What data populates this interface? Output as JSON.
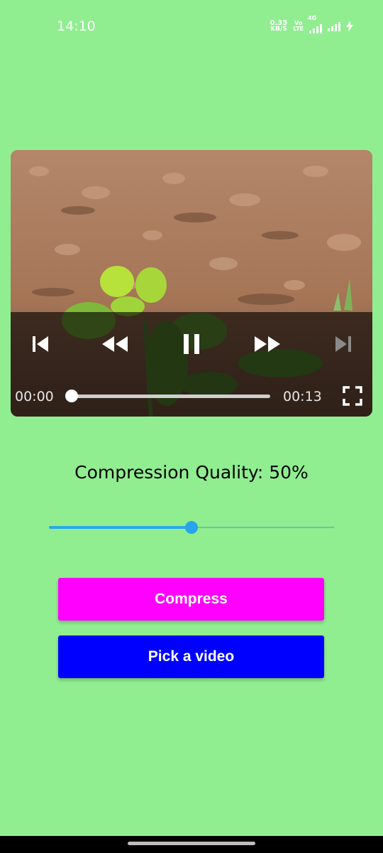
{
  "status_bar": {
    "time": "14:10",
    "net_speed_value": "0.35",
    "net_speed_unit": "KB/S",
    "volte_top": "Vo",
    "volte_bottom": "LTE",
    "network_type": "4G",
    "icons": [
      "network-speed-icon",
      "volte-icon",
      "signal-4g-icon",
      "signal-icon",
      "charging-icon"
    ]
  },
  "player": {
    "current_time": "00:00",
    "duration": "00:13",
    "progress": 0.0,
    "icons": [
      "skip-previous-icon",
      "rewind-icon",
      "pause-icon",
      "fast-forward-icon",
      "skip-next-icon",
      "fullscreen-icon"
    ]
  },
  "compression": {
    "label_prefix": "Compression Quality: ",
    "value": "50%",
    "slider_value": 0.5
  },
  "buttons": {
    "compress_label": "Compress",
    "pick_label": "Pick a video"
  },
  "colors": {
    "background": "#90EE90",
    "compress": "#FF00FF",
    "pick": "#0000FF",
    "slider_accent": "#2AA8E8"
  }
}
